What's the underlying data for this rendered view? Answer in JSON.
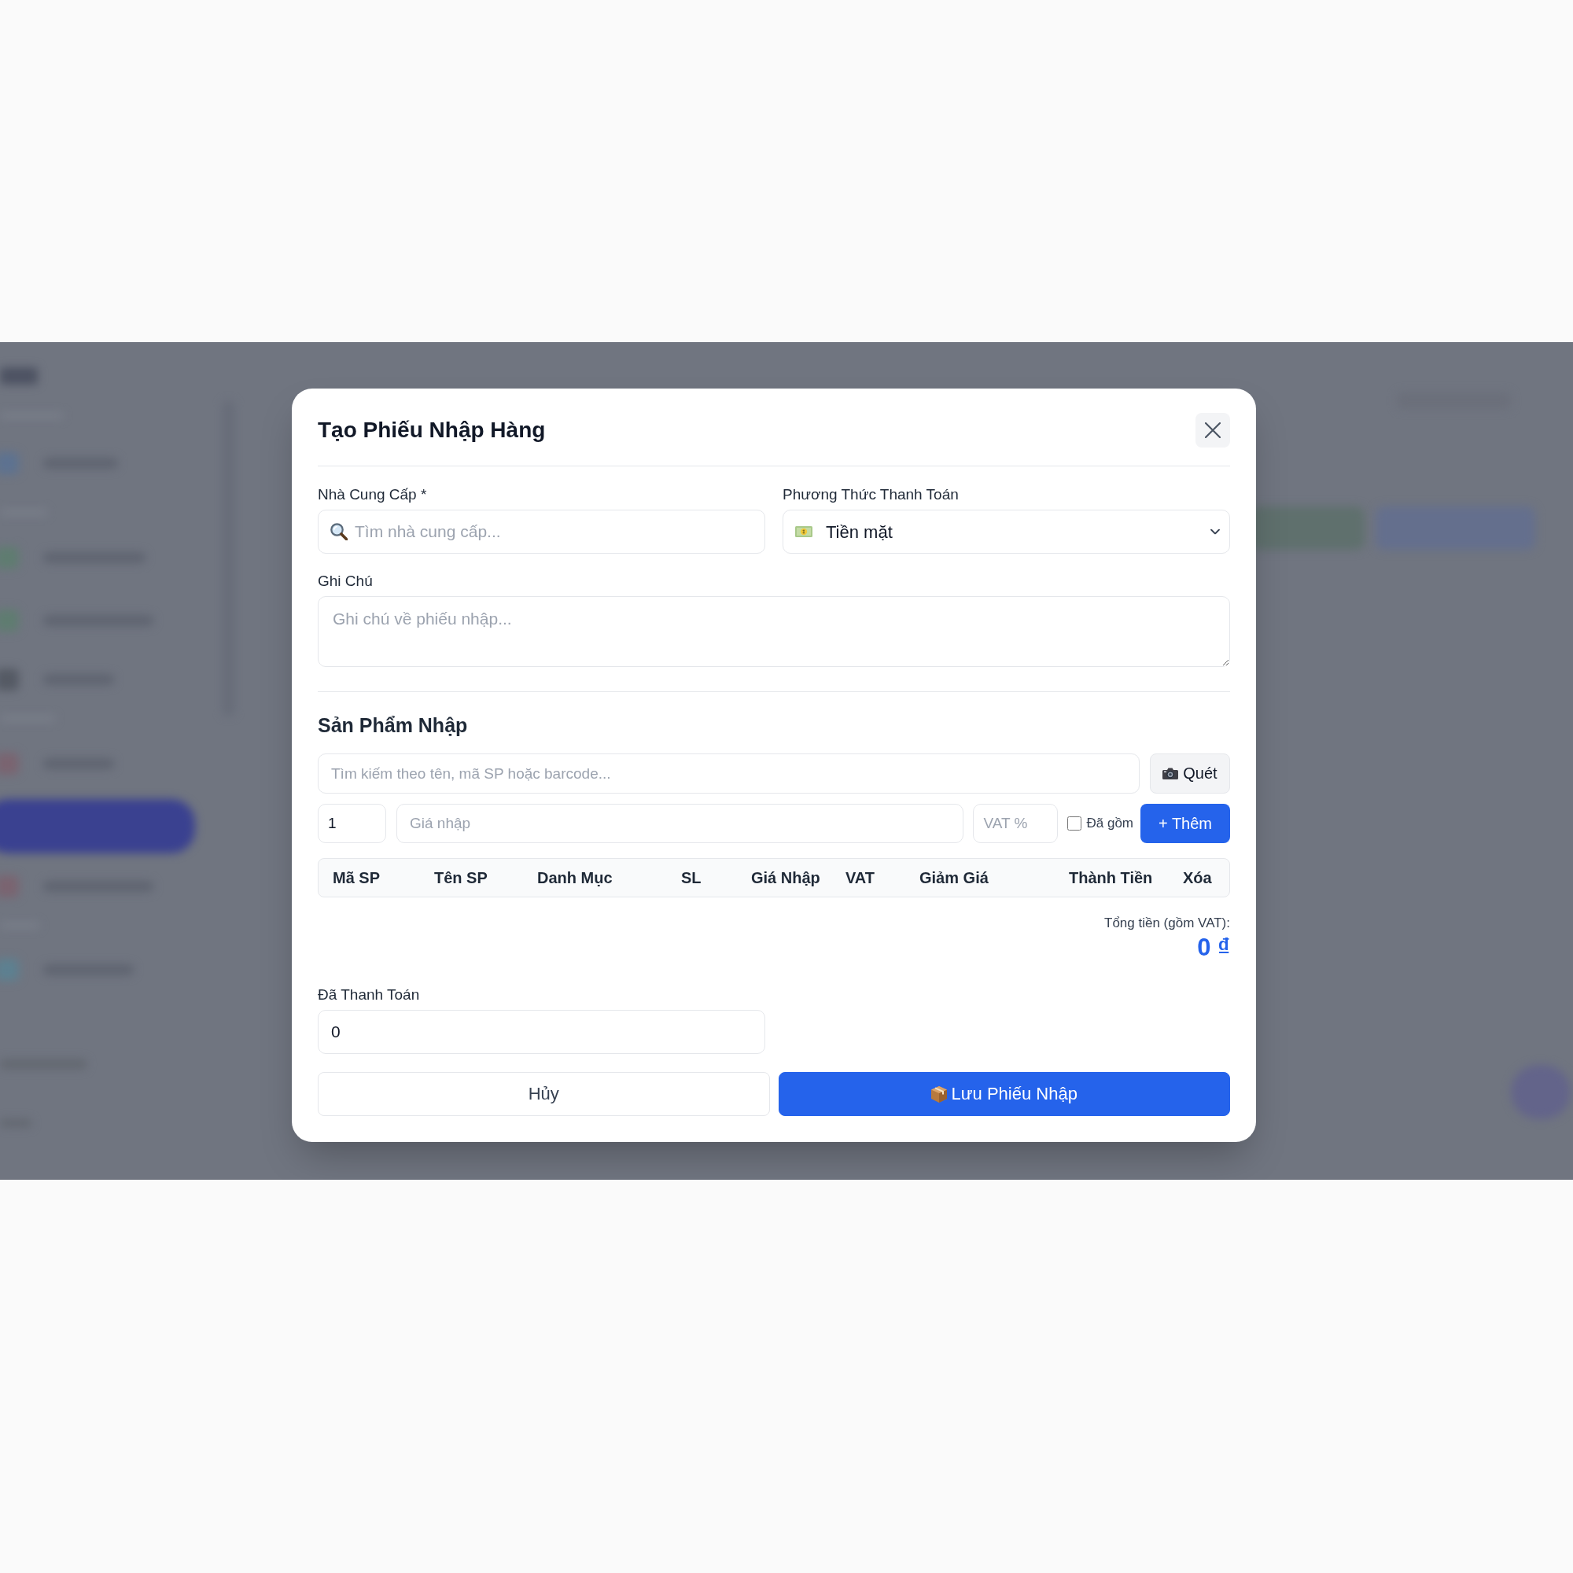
{
  "dialog": {
    "title": "Tạo Phiếu Nhập Hàng"
  },
  "form": {
    "supplier": {
      "label": "Nhà Cung Cấp *",
      "placeholder": "Tìm nhà cung cấp..."
    },
    "payment_method": {
      "label": "Phương Thức Thanh Toán",
      "value": "Tiền mặt"
    },
    "note": {
      "label": "Ghi Chú",
      "placeholder": "Ghi chú về phiếu nhập..."
    }
  },
  "products": {
    "title": "Sản Phẩm Nhập",
    "search": {
      "placeholder": "Tìm kiếm theo tên, mã SP hoặc barcode..."
    },
    "scan_button": {
      "label": "Quét"
    },
    "quantity": {
      "value": "1"
    },
    "price": {
      "placeholder": "Giá nhập"
    },
    "vat": {
      "placeholder": "VAT %"
    },
    "vat_included": {
      "label": "Đã gồm",
      "checked": false
    },
    "add_button": {
      "label": "+ Thêm"
    },
    "table": {
      "columns": [
        "Mã SP",
        "Tên SP",
        "Danh Mục",
        "SL",
        "Giá Nhập",
        "VAT",
        "Giảm Giá",
        "Thành Tiền",
        "Xóa"
      ]
    }
  },
  "total": {
    "label": "Tổng tiền (gồm VAT):",
    "value": "0 ₫"
  },
  "paid": {
    "label": "Đã Thanh Toán",
    "value": "0"
  },
  "buttons": [
    {
      "label": "Hủy",
      "kind": "secondary"
    },
    {
      "label": "Lưu Phiếu Nhập",
      "kind": "primary"
    }
  ]
}
